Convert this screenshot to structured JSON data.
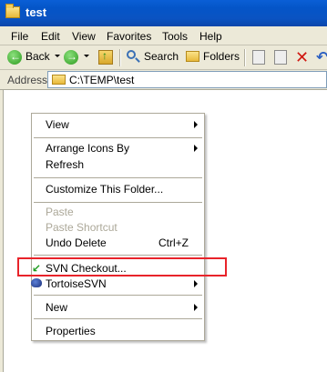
{
  "window": {
    "title": "test"
  },
  "menubar": {
    "items": [
      "File",
      "Edit",
      "View",
      "Favorites",
      "Tools",
      "Help"
    ]
  },
  "toolbar": {
    "back_label": "Back",
    "search_label": "Search",
    "folders_label": "Folders"
  },
  "address": {
    "label": "Address",
    "value": "C:\\TEMP\\test"
  },
  "context_menu": {
    "view": "View",
    "arrange": "Arrange Icons By",
    "refresh": "Refresh",
    "customize": "Customize This Folder...",
    "paste": "Paste",
    "paste_shortcut": "Paste Shortcut",
    "undo_delete": "Undo Delete",
    "undo_shortcut": "Ctrl+Z",
    "svn_checkout": "SVN Checkout...",
    "tortoise": "TortoiseSVN",
    "new": "New",
    "properties": "Properties"
  },
  "colors": {
    "title_bar": "#0455c8",
    "chrome": "#ece9d8",
    "highlight_box": "#e8232a"
  }
}
